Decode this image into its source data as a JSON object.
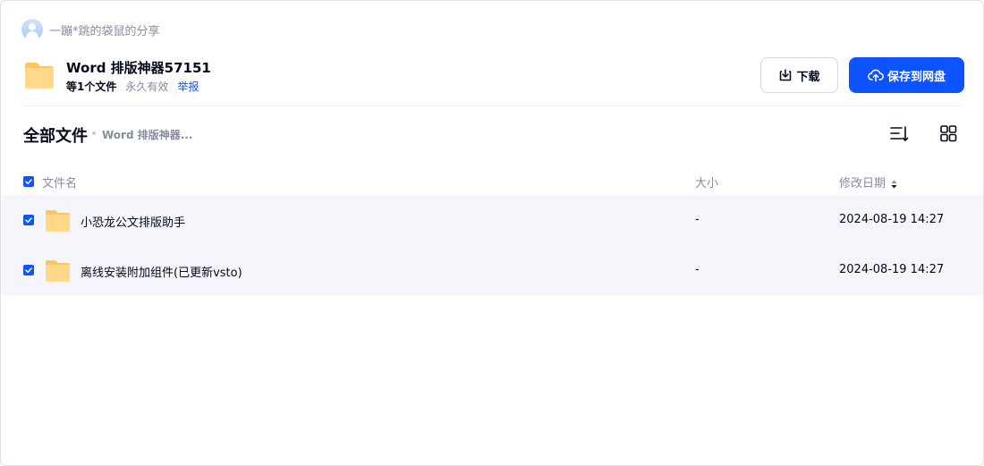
{
  "owner": {
    "name": "一蹦*跳的袋鼠的分享"
  },
  "share": {
    "title": "Word 排版神器57151",
    "file_count": "等1个文件",
    "validity": "永久有效",
    "report_label": "举报"
  },
  "actions": {
    "download_label": "下载",
    "save_label": "保存到网盘"
  },
  "breadcrumb": {
    "root": "全部文件",
    "current": "Word 排版神器..."
  },
  "table": {
    "headers": {
      "name": "文件名",
      "size": "大小",
      "modified": "修改日期"
    },
    "rows": [
      {
        "name": "小恐龙公文排版助手",
        "size": "-",
        "modified": "2024-08-19 14:27"
      },
      {
        "name": "离线安装附加组件(已更新vsto)",
        "size": "-",
        "modified": "2024-08-19 14:27"
      }
    ]
  },
  "colors": {
    "accent": "#0d53ff",
    "row_bg": "#f5f6fb",
    "folder": "#ffc55d"
  },
  "icons": {
    "avatar": "user-avatar-icon",
    "folder": "folder-icon",
    "download": "download-icon",
    "save": "cloud-upload-icon",
    "sort": "sort-icon",
    "grid": "grid-view-icon",
    "checkbox": "checkbox-checked-icon"
  }
}
